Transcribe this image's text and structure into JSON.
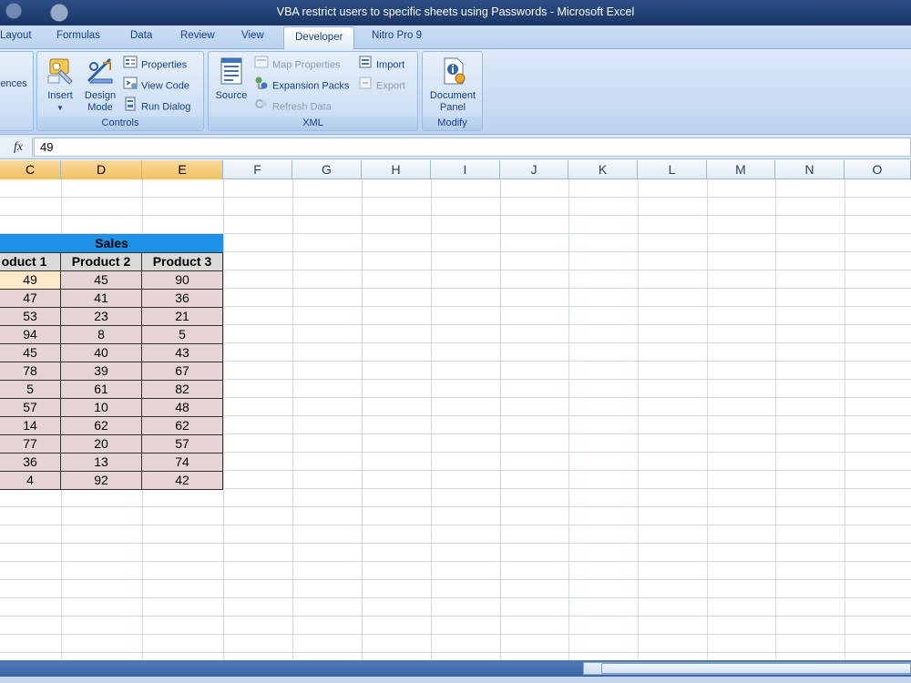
{
  "window": {
    "title": "VBA restrict users to specific sheets using Passwords - Microsoft Excel"
  },
  "tabs": [
    {
      "label": "Layout"
    },
    {
      "label": "Formulas"
    },
    {
      "label": "Data"
    },
    {
      "label": "Review"
    },
    {
      "label": "View"
    },
    {
      "label": "Developer"
    },
    {
      "label": "Nitro Pro 9"
    }
  ],
  "active_tab": "Developer",
  "ribbon": {
    "code_partial_label": "ences",
    "controls": {
      "label": "Controls",
      "insert": "Insert",
      "design_mode": "Design Mode",
      "properties": "Properties",
      "view_code": "View Code",
      "run_dialog": "Run Dialog"
    },
    "xml": {
      "label": "XML",
      "source": "Source",
      "map_properties": "Map Properties",
      "expansion_packs": "Expansion Packs",
      "refresh_data": "Refresh Data",
      "import": "Import",
      "export": "Export"
    },
    "modify": {
      "label": "Modify",
      "document_panel": "Document Panel"
    }
  },
  "formula_bar": {
    "fx": "fx",
    "value": "49"
  },
  "columns": [
    "C",
    "D",
    "E",
    "F",
    "G",
    "H",
    "I",
    "J",
    "K",
    "L",
    "M",
    "N",
    "O"
  ],
  "selected_columns": [
    "C",
    "D",
    "E"
  ],
  "table": {
    "title": "Sales",
    "headers": [
      "oduct 1",
      "Product 2",
      "Product 3"
    ],
    "rows": [
      [
        49,
        45,
        90
      ],
      [
        47,
        41,
        36
      ],
      [
        53,
        23,
        21
      ],
      [
        94,
        8,
        5
      ],
      [
        45,
        40,
        43
      ],
      [
        78,
        39,
        67
      ],
      [
        5,
        61,
        82
      ],
      [
        57,
        10,
        48
      ],
      [
        14,
        62,
        62
      ],
      [
        77,
        20,
        57
      ],
      [
        36,
        13,
        74
      ],
      [
        4,
        92,
        42
      ]
    ]
  },
  "colors": {
    "sales_header": "#1e90e6",
    "data_fill": "#e6d4d4",
    "active_cell": "#fde9c8"
  }
}
